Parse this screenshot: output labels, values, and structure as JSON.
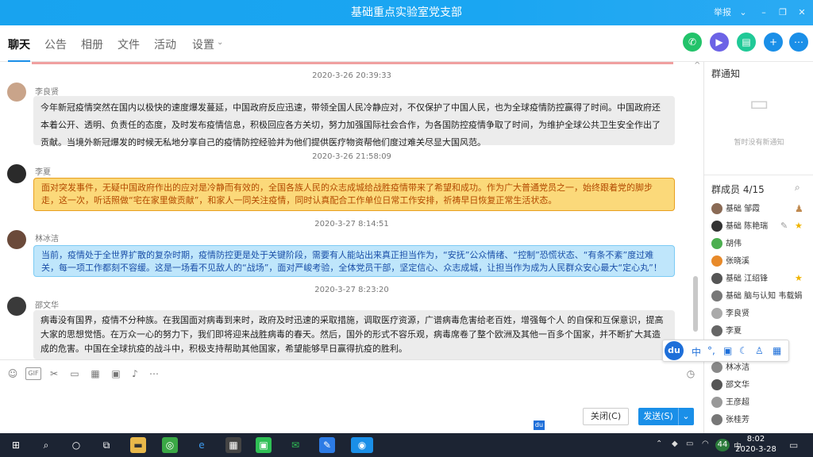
{
  "window": {
    "title": "基础重点实验室党支部",
    "report": "举报",
    "minimize": "–",
    "restore": "❐",
    "close": "✕"
  },
  "tabs": [
    {
      "label": "聊天"
    },
    {
      "label": "公告"
    },
    {
      "label": "相册"
    },
    {
      "label": "文件"
    },
    {
      "label": "活动"
    },
    {
      "label": "设置"
    }
  ],
  "messages": [
    {
      "time": "2020-3-26 20:39:33",
      "sender": "李良贤",
      "text": "今年新冠疫情突然在国内以极快的速度爆发蔓延，中国政府反应迅速，带领全国人民冷静应对，不仅保护了中国人民，也为全球疫情防控赢得了时间。中国政府还本着公开、透明、负责任的态度，及时发布疫情信息，积极回应各方关切，努力加强国际社会合作，为各国防控疫情争取了时间，为维护全球公共卫生安全作出了贡献。当境外新冠爆发的时候无私地分享自己的疫情防控经验并为他们提供医疗物资帮他们度过难关尽显大国风范。"
    },
    {
      "time": "2020-3-26 21:58:09",
      "sender": "李夏",
      "text": "面对突发事件，无疑中国政府作出的应对是冷静而有效的，全国各族人民的众志成城给战胜疫情带来了希望和成功。作为广大普通党员之一，始终跟着党的脚步走，这一次，听话照做“宅在家里做贡献”，和家人一同关注疫情，同时认真配合工作单位日常工作安排，祈祷早日恢复正常生活状态。"
    },
    {
      "time": "2020-3-27 8:14:51",
      "sender": "林冰洁",
      "text": "当前，疫情处于全世界扩散的复杂时期，疫情防控更是处于关键阶段，需要有人能站出来真正担当作为，“安抚”公众情绪、“控制”恐慌状态、“有条不紊”度过难关，每一项工作都刻不容缓。这是一场看不见敌人的“战场”，面对严峻考验，全体党员干部，坚定信心、众志成城，让担当作为成为人民群众安心最大“定心丸”！"
    },
    {
      "time": "2020-3-27 8:23:20",
      "sender": "邵文华",
      "text": "病毒没有国界，疫情不分种族。在我国面对病毒到来时，政府及时迅速的采取措施，调取医疗资源，广谱病毒危害给老百姓，增强每个人 的自保和互保意识，提高大家的思想觉悟。在万众一心的努力下，我们即将迎来战胜病毒的春天。然后，国外的形式不容乐观，病毒席卷了整个欧洲及其他一百多个国家，并不断扩大其造成的危害。中国在全球抗疫的战斗中，积极支持帮助其他国家，希望能够早日赢得抗疫的胜利。"
    }
  ],
  "input": {
    "close_label": "关闭(C)",
    "send_label": "发送(S)"
  },
  "sidebar": {
    "notice_title": "群通知",
    "notice_empty": "暂时没有新通知",
    "members_title": "群成员 4/15",
    "members": [
      {
        "name": "基础 邹霞",
        "color": "#8a6a55"
      },
      {
        "name": "基础 陈艳瑞",
        "color": "#333333"
      },
      {
        "name": "胡伟",
        "color": "#4caf50"
      },
      {
        "name": "张晓溪",
        "color": "#e88a2a"
      },
      {
        "name": "基础 江绍锋",
        "color": "#555555"
      },
      {
        "name": "基础 脑与认知 韦载娟",
        "color": "#777777"
      },
      {
        "name": "李良贤",
        "color": "#aaaaaa"
      },
      {
        "name": "李夏",
        "color": "#666666"
      },
      {
        "name": "林冰洁",
        "color": "#888888"
      },
      {
        "name": "邵文华",
        "color": "#555555"
      },
      {
        "name": "王彦超",
        "color": "#999999"
      },
      {
        "name": "张桂芳",
        "color": "#777777"
      }
    ]
  },
  "ime": {
    "logo": "du",
    "mode": "中"
  },
  "taskbar": {
    "time": "8:02",
    "date": "2020-3-28",
    "badge": "44"
  }
}
